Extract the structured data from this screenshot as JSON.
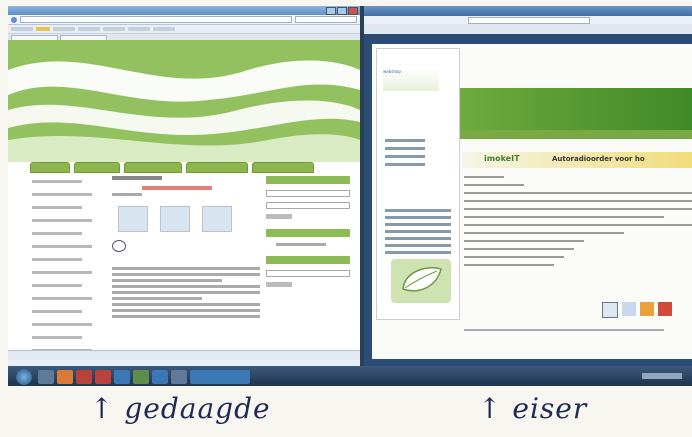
{
  "left_window": {
    "role": "defendant-browser",
    "accent_color": "#8db54f"
  },
  "right_window": {
    "role": "plaintiff-browser",
    "brand": "imokeIT",
    "tagline": "Autoradioorder voor ho",
    "logo_text": "webshop",
    "accent_color": "#6eaa3c"
  },
  "annotations": {
    "left_label": "gedaagde",
    "right_label": "eiser",
    "arrow": "↑"
  },
  "taskbar": {
    "icons": [
      "start-orb",
      "explorer-icon",
      "media-icon",
      "firefox-icon",
      "pdf-icon",
      "word-icon",
      "excel-icon",
      "chrome-icon",
      "outlook-icon"
    ]
  }
}
